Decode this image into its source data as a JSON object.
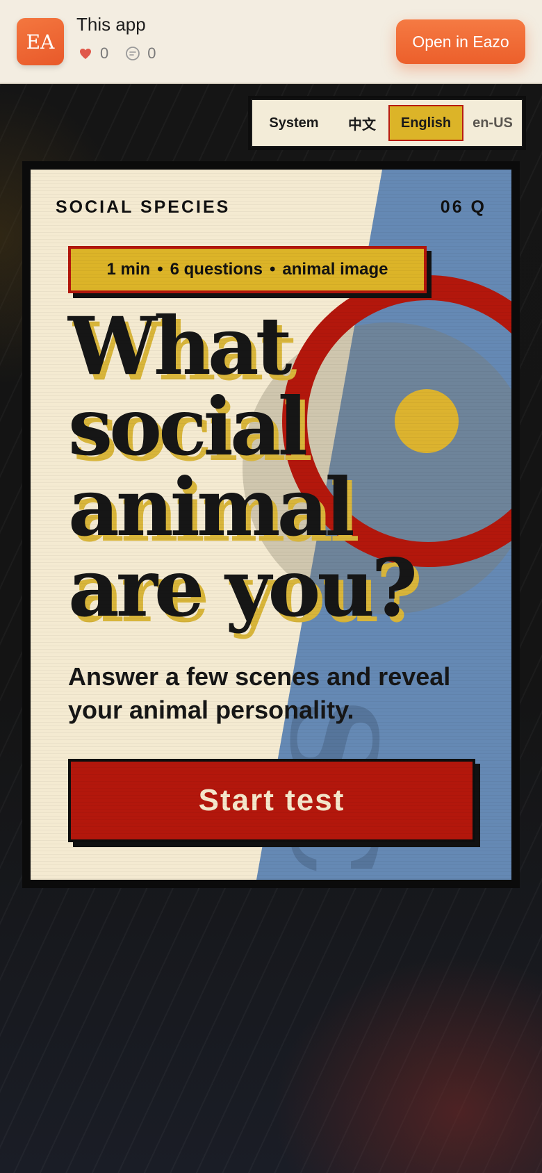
{
  "banner": {
    "app_icon_text": "EA",
    "app_title": "This app",
    "likes_count": "0",
    "comments_count": "0",
    "open_button": "Open in Eazo",
    "accent_color": "#ec5f2b"
  },
  "language_switch": {
    "options": [
      "System",
      "中文",
      "English",
      "en-US"
    ],
    "selected": "English"
  },
  "quiz_card": {
    "brand": "SOCIAL SPECIES",
    "question_count": "06 Q",
    "meta": {
      "duration": "1 min",
      "questions": "6 questions",
      "result": "animal image",
      "separator": "•"
    },
    "headline_lines": [
      "What",
      "social",
      "animal",
      "are you?"
    ],
    "subtitle": "Answer a few scenes and reveal your animal personality.",
    "start_button": "Start test",
    "decorative_letters": "SC",
    "colors": {
      "cream": "#f4ead1",
      "blue": "#6589b4",
      "red": "#b3170c",
      "yellow": "#dcb428",
      "ink": "#161616"
    }
  }
}
